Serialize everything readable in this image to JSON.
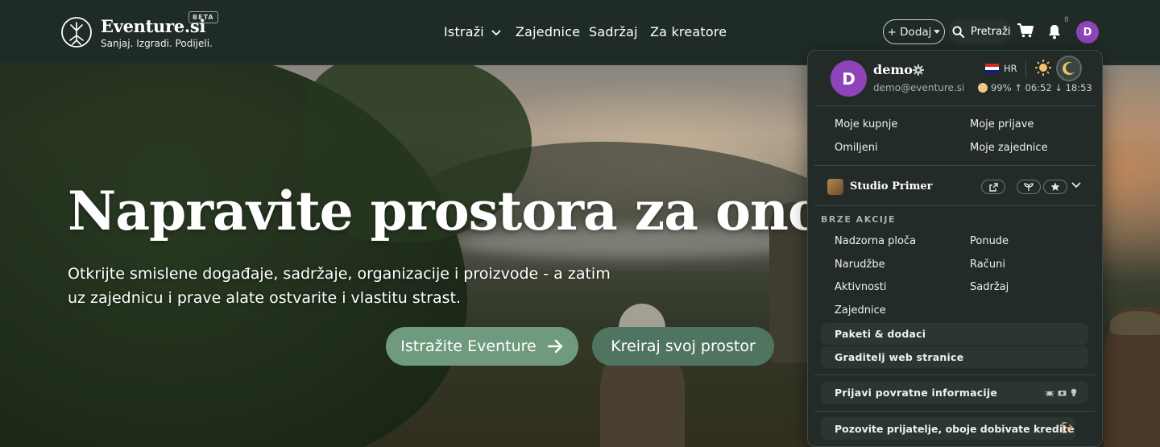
{
  "brand": {
    "name": "Eventure.si",
    "badge": "BETA",
    "tagline": "Sanjaj. Izgradi. Podijeli."
  },
  "nav": {
    "explore": "Istraži",
    "communities": "Zajednice",
    "content": "Sadržaj",
    "creators": "Za kreatore"
  },
  "actions": {
    "add": "+ Dodaj",
    "search": "Pretraži",
    "notification_count": "8",
    "avatar_initial": "D"
  },
  "hero": {
    "title": "Napravite prostora za ono što va",
    "subtitle": "Otkrijte smislene događaje, sadržaje, organizacije i proizvode - a zatim uz zajednicu i prave alate ostvarite i vlastitu strast.",
    "primary_cta": "Istražite Eventure",
    "secondary_cta": "Kreiraj svoj prostor"
  },
  "menu": {
    "user": {
      "initial": "D",
      "name": "demo",
      "email": "demo@eventure.si"
    },
    "language": "HR",
    "weather": "99% ↑ 06:52 ↓ 18:53",
    "quick_links": [
      "Moje kupnje",
      "Moje prijave",
      "Omiljeni",
      "Moje zajednice"
    ],
    "studio": {
      "name": "Studio Primer"
    },
    "section_label": "BRZE AKCIJE",
    "quick_actions": [
      "Nadzorna ploča",
      "Ponude",
      "Narudžbe",
      "Računi",
      "Aktivnosti",
      "Sadržaj",
      "Zajednice"
    ],
    "highlighted": [
      "Paketi & dodaci",
      "Graditelj web stranice"
    ],
    "feedback": "Prijavi povratne informacije",
    "invite": "Pozovite prijatelje, oboje dobivate kredite"
  },
  "colors": {
    "header_bg": "#1f2b27",
    "accent_purple": "#8e43b8",
    "cta_green": "#6f9a7e",
    "cta_dark_green": "#4f7560"
  }
}
